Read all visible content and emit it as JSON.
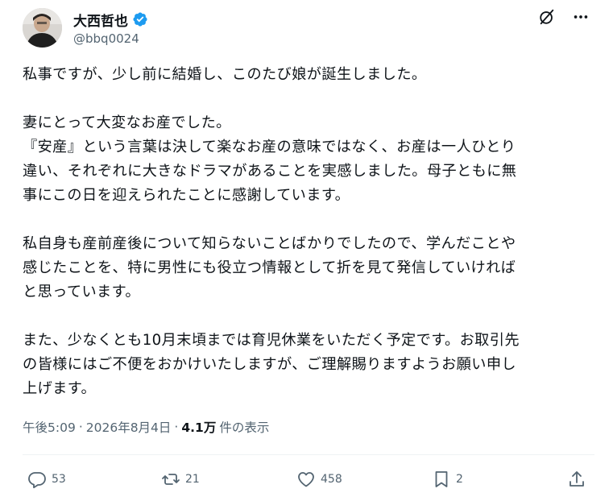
{
  "author": {
    "display_name": "大西哲也",
    "handle": "@bbq0024",
    "verified": true,
    "verified_color": "#1d9bf0"
  },
  "header_icons": [
    "grok-icon",
    "more-icon"
  ],
  "body": {
    "paragraphs": [
      [
        "私事ですが、少し前に結婚し、このたび娘が誕生しました。"
      ],
      [
        "妻にとって大変なお産でした。",
        "『安産』という言葉は決して楽なお産の意味ではなく、お産は一人ひとり",
        "違い、それぞれに大きなドラマがあることを実感しました。母子ともに無",
        "事にこの日を迎えられたことに感謝しています。"
      ],
      [
        "私自身も産前産後について知らないことばかりでしたので、学んだことや",
        "感じたことを、特に男性にも役立つ情報として折を見て発信していければ",
        "と思っています。"
      ],
      [
        "また、少なくとも10月末頃までは育児休業をいただく予定です。お取引先",
        "の皆様にはご不便をおかけいたしますが、ご理解賜りますようお願い申し",
        "上げます。"
      ]
    ]
  },
  "meta": {
    "time": "午後5:09",
    "separator": "·",
    "date": "2026年8月4日",
    "views_count": "4.1万",
    "views_label": "件の表示"
  },
  "actions": {
    "reply": {
      "icon": "reply-icon",
      "count": "53"
    },
    "retweet": {
      "icon": "retweet-icon",
      "count": "21"
    },
    "like": {
      "icon": "heart-icon",
      "count": "458"
    },
    "bookmark": {
      "icon": "bookmark-icon",
      "count": "2"
    },
    "share": {
      "icon": "share-icon"
    }
  },
  "colors": {
    "text": "#0f1419",
    "secondary": "#536471",
    "divider": "#eff3f4"
  }
}
